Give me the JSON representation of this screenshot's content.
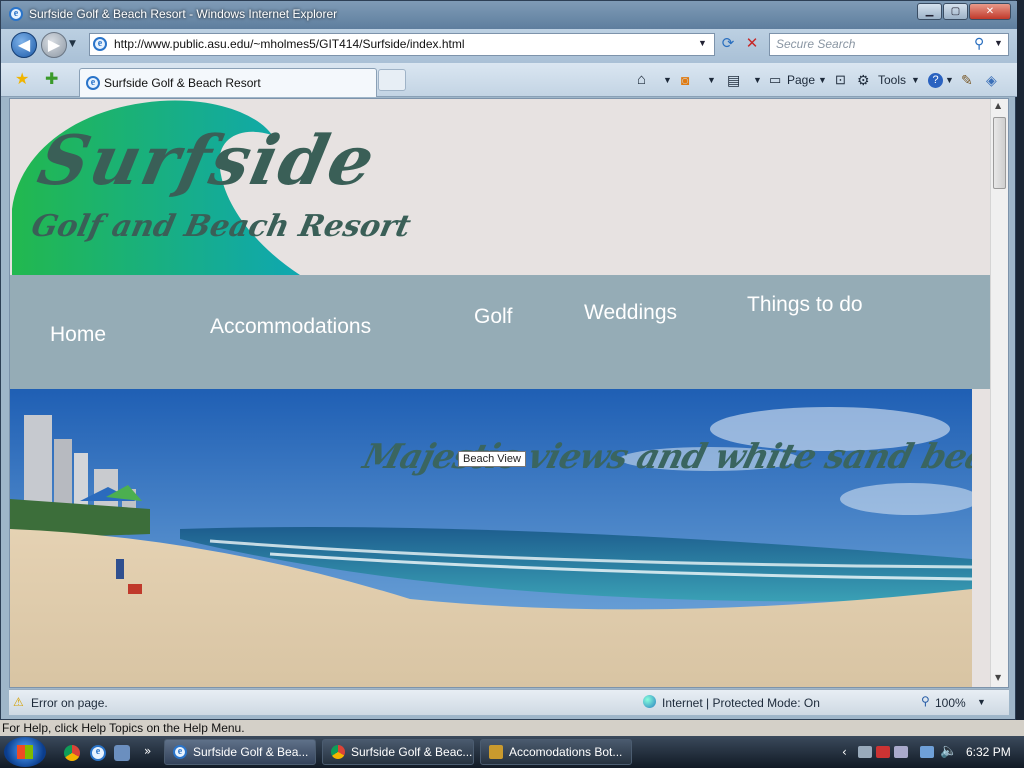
{
  "window": {
    "title": "Surfside Golf & Beach Resort - Windows Internet Explorer"
  },
  "address": {
    "url": "http://www.public.asu.edu/~mholmes5/GIT414/Surfside/index.html"
  },
  "search": {
    "placeholder": "Secure Search"
  },
  "tab": {
    "label": "Surfside Golf & Beach Resort"
  },
  "command_bar": {
    "page_label": "Page",
    "tools_label": "Tools"
  },
  "site": {
    "logo_title": "Surfside",
    "logo_subtitle": "Golf and Beach Resort",
    "nav": [
      "Home",
      "Accommodations",
      "Golf",
      "Weddings",
      "Things to do"
    ],
    "banner_caption": "Majestic views and white sand beaches",
    "banner_tooltip": "Beach View"
  },
  "statusbar": {
    "error_text": "Error on page.",
    "zone_text": "Internet | Protected Mode: On",
    "zoom": "100%"
  },
  "helpline": "For Help, click Help Topics on the Help Menu.",
  "taskbar": {
    "items": [
      "Surfside Golf & Bea...",
      "Surfside Golf & Beac...",
      "Accomodations Bot..."
    ],
    "clock": "6:32 PM"
  },
  "colors": {
    "nav_band": "#95acb6",
    "header_bg": "#e7e2e1",
    "logo_text": "#3a5f57",
    "wave_green": "#1db86a",
    "wave_teal": "#14a9a4"
  }
}
